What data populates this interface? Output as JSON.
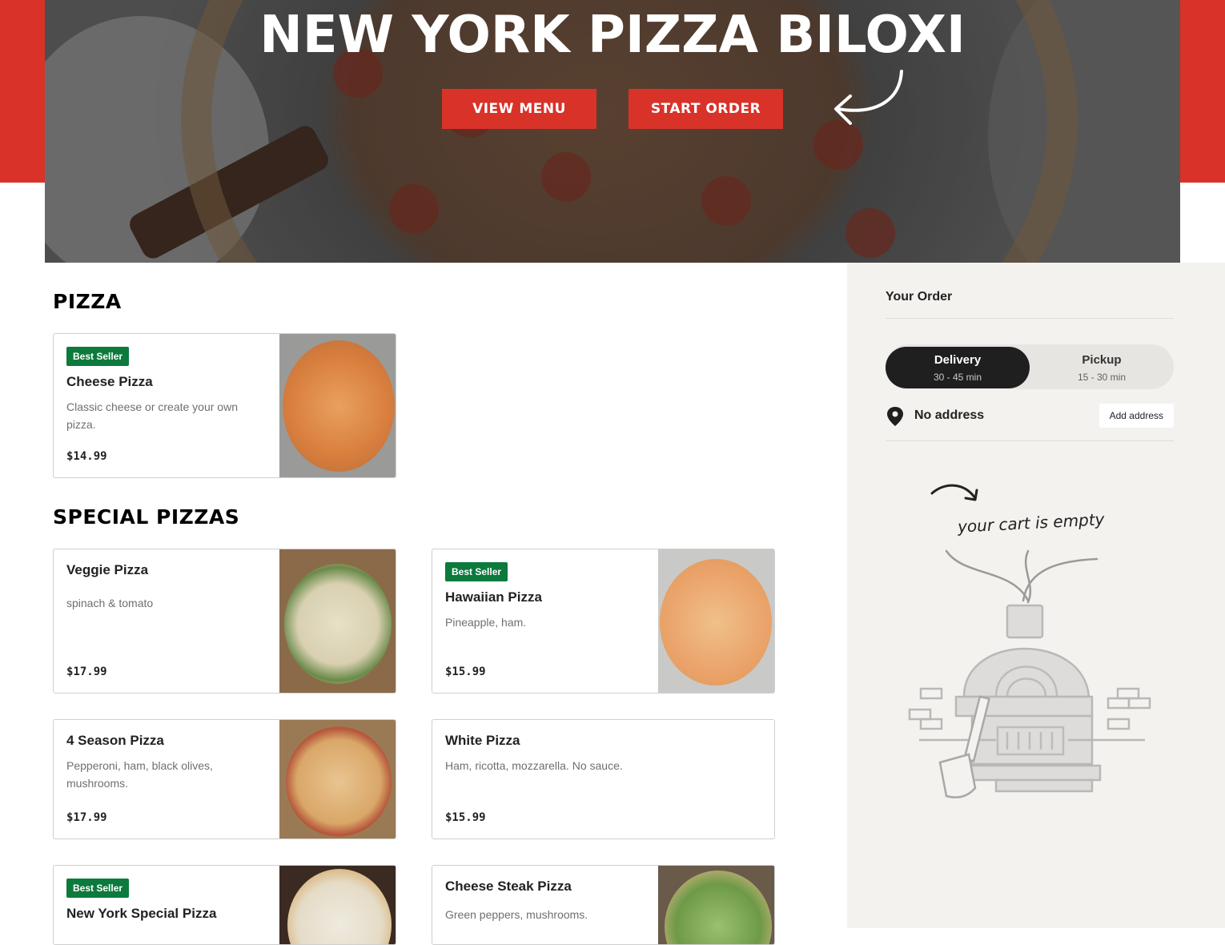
{
  "hero": {
    "title": "NEW YORK PIZZA BILOXI",
    "view_menu": "VIEW MENU",
    "start_order": "START ORDER"
  },
  "sections": [
    {
      "title": "PIZZA"
    },
    {
      "title": "SPECIAL PIZZAS"
    }
  ],
  "items": [
    {
      "badge": "Best Seller",
      "name": "Cheese Pizza",
      "desc": "Classic cheese or create your own pizza.",
      "price": "$14.99"
    },
    {
      "badge": "",
      "name": "Veggie Pizza",
      "desc": "spinach & tomato",
      "price": "$17.99"
    },
    {
      "badge": "Best Seller",
      "name": "Hawaiian Pizza",
      "desc": "Pineapple, ham.",
      "price": "$15.99"
    },
    {
      "badge": "",
      "name": "4 Season Pizza",
      "desc": "Pepperoni, ham, black olives, mushrooms.",
      "price": "$17.99"
    },
    {
      "badge": "",
      "name": "White Pizza",
      "desc": "Ham, ricotta, mozzarella. No sauce.",
      "price": "$15.99"
    },
    {
      "badge": "Best Seller",
      "name": "New York Special Pizza",
      "desc": "",
      "price": ""
    },
    {
      "badge": "",
      "name": "Cheese Steak Pizza",
      "desc": "Green peppers, mushrooms.",
      "price": ""
    }
  ],
  "order": {
    "title": "Your Order",
    "delivery_label": "Delivery",
    "delivery_time": "30 - 45 min",
    "pickup_label": "Pickup",
    "pickup_time": "15 - 30 min",
    "address": "No address",
    "add_address": "Add address",
    "empty_message": "your cart is empty"
  },
  "colors": {
    "brand_red": "#d93229",
    "badge_green": "#0c7a3c",
    "sidebar_bg": "#f3f2ef",
    "toggle_active": "#1f1f1f"
  },
  "icons": {
    "hero_arrow": "curved-arrow-icon",
    "location": "map-pin-icon",
    "empty_cart_arrow": "curved-arrow-icon",
    "empty_cart_illustration": "pizza-oven-illustration"
  }
}
